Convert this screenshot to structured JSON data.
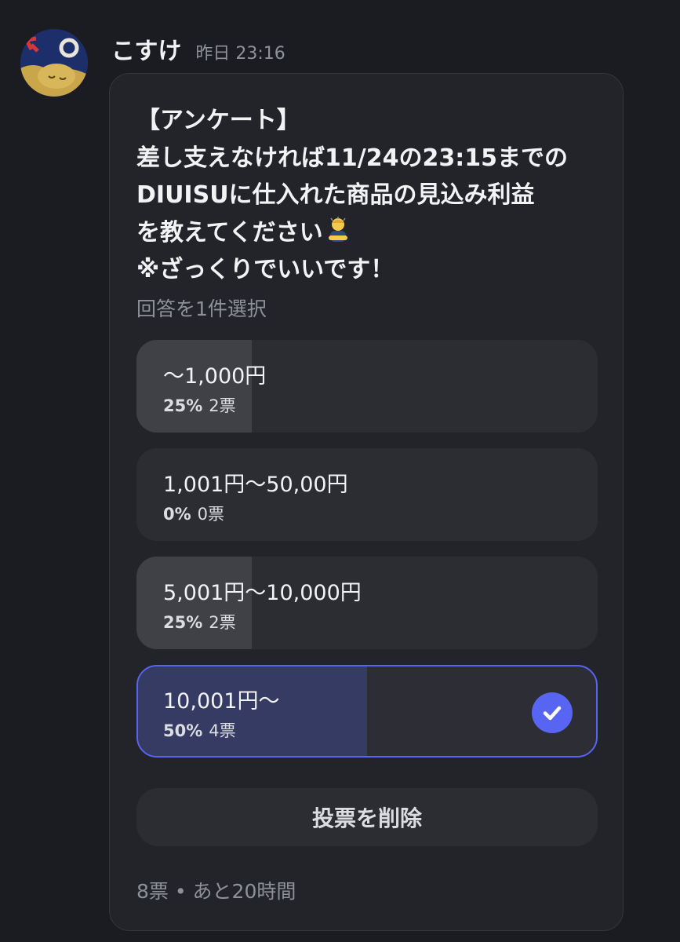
{
  "message": {
    "author": "こすけ",
    "timestamp": "昨日 23:16"
  },
  "poll": {
    "question": "【アンケート】\n差し支えなければ11/24の23:15までの\nDIUISUに仕入れた商品の見込み利益\nを教えてください",
    "question_tail": "※ざっくりでいいです！",
    "emoji": "bowing-person",
    "instruction": "回答を1件選択",
    "options": [
      {
        "label": "〜1,000円",
        "percent_text": "25%",
        "votes_text": "2票",
        "fraction": 0.25,
        "selected": false
      },
      {
        "label": "1,001円〜50,00円",
        "percent_text": "0%",
        "votes_text": "0票",
        "fraction": 0.0,
        "selected": false
      },
      {
        "label": "5,001円〜10,000円",
        "percent_text": "25%",
        "votes_text": "2票",
        "fraction": 0.25,
        "selected": false
      },
      {
        "label": "10,001円〜",
        "percent_text": "50%",
        "votes_text": "4票",
        "fraction": 0.5,
        "selected": true
      }
    ],
    "remove_vote_label": "投票を削除",
    "footer": "8票 • あと20時間"
  },
  "colors": {
    "background": "#1b1c21",
    "card": "#232429",
    "option": "#2c2d33",
    "option_fill": "#3f4147",
    "selected_fill": "#363b63",
    "accent": "#5865f2"
  }
}
